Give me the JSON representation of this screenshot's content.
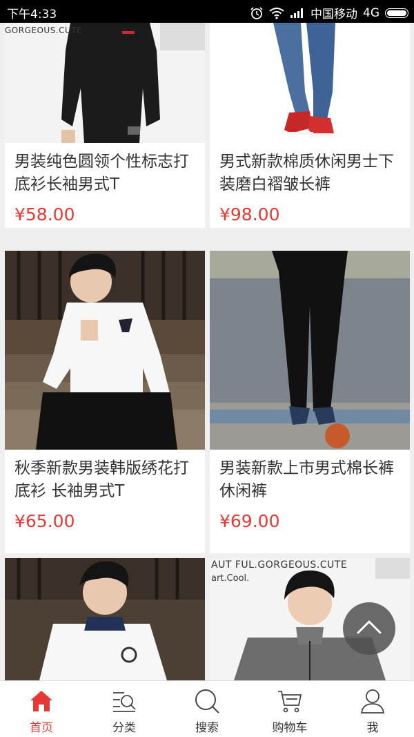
{
  "status_bar": {
    "time": "下午4:33",
    "carrier": "中国移动",
    "network": "4G"
  },
  "products": [
    {
      "title": "男装纯色圆领个性标志打底衫长袖男式T",
      "price": "¥58.00",
      "image": "black-long-sleeve-tshirt"
    },
    {
      "title": "男式新款棉质休闲男士下装磨白褶皱长裤",
      "price": "¥98.00",
      "image": "blue-jeans-red-shoes"
    },
    {
      "title": "秋季新款男装韩版绣花打底衫 长袖男式T",
      "price": "¥65.00",
      "image": "white-henley-shirt"
    },
    {
      "title": "男装新款上市男式棉长裤休闲裤",
      "price": "¥69.00",
      "image": "black-casual-pants"
    },
    {
      "title": "",
      "price": "",
      "image": "white-polo-shirt"
    },
    {
      "title": "",
      "price": "",
      "image": "grey-stand-collar-shirt"
    }
  ],
  "image_texts": {
    "gorgeous_cute": "GORGEOUS.CUTE",
    "beautiful_gorgeous": "AUT FUL.GORGEOUS.CUTE",
    "art_cool": "art.Cool."
  },
  "nav": {
    "tabs": [
      {
        "label": "首页",
        "icon": "home-icon",
        "active": true
      },
      {
        "label": "分类",
        "icon": "category-icon",
        "active": false
      },
      {
        "label": "搜索",
        "icon": "search-icon",
        "active": false
      },
      {
        "label": "购物车",
        "icon": "cart-icon",
        "active": false
      },
      {
        "label": "我",
        "icon": "user-icon",
        "active": false
      }
    ]
  },
  "colors": {
    "accent": "#e53935",
    "background": "#efefef"
  }
}
